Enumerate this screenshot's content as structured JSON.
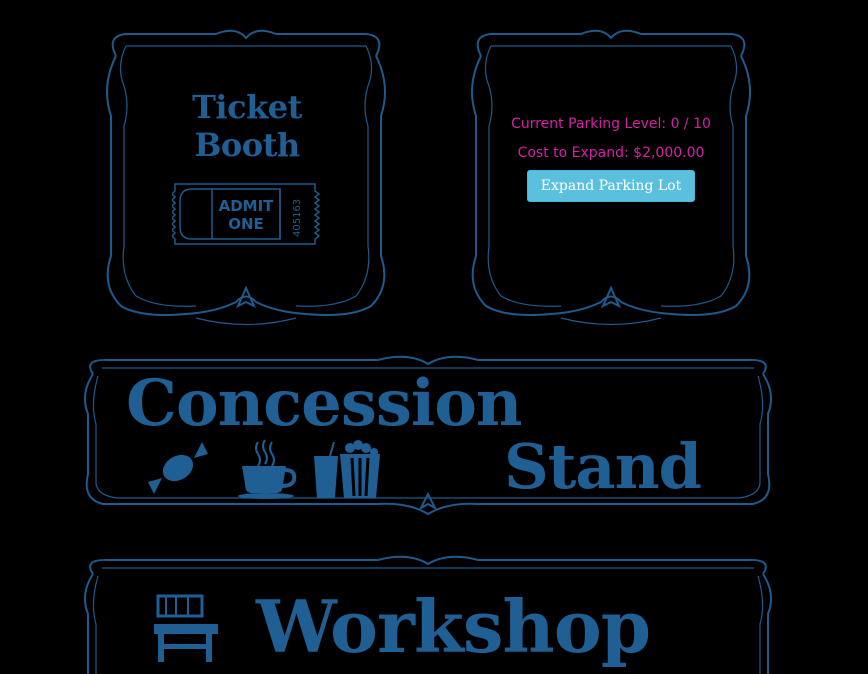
{
  "ticket_booth": {
    "title": "Ticket Booth",
    "ticket_line1": "ADMIT",
    "ticket_line2": "ONE",
    "ticket_number": "405163"
  },
  "parking": {
    "level_text": "Current Parking Level: 0 / 10",
    "cost_text": "Cost to Expand: $2,000.00",
    "expand_button": "Expand Parking Lot"
  },
  "concession": {
    "title_line1": "Concession",
    "title_line2": "Stand",
    "icons": [
      "candy-icon",
      "coffee-cup-icon",
      "popcorn-drink-icon"
    ]
  },
  "workshop": {
    "title": "Workshop",
    "icons": [
      "workbench-icon"
    ]
  },
  "colors": {
    "background": "#000000",
    "frame": "#1e5a8c",
    "title": "#1f5f93",
    "info_text": "#d81fa8",
    "button": "#5bc0de"
  }
}
